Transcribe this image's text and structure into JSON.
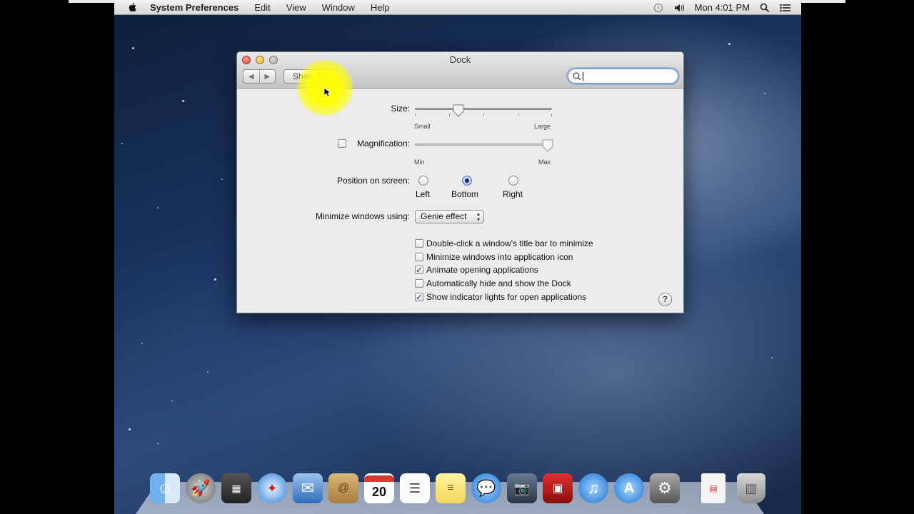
{
  "menubar": {
    "app": "System Preferences",
    "items": [
      "Edit",
      "View",
      "Window",
      "Help"
    ],
    "clock": "Mon 4:01 PM"
  },
  "window": {
    "title": "Dock",
    "nav_back": "◀",
    "nav_forward": "▶",
    "show_all": "Show All",
    "search_placeholder": ""
  },
  "dock_prefs": {
    "size_label": "Size:",
    "size_min": "Small",
    "size_max": "Large",
    "size_value": 0.32,
    "magnification_label": "Magnification:",
    "magnification_checked": false,
    "mag_min": "Min",
    "mag_max": "Max",
    "mag_value": 0.97,
    "position_label": "Position on screen:",
    "positions": [
      "Left",
      "Bottom",
      "Right"
    ],
    "position_selected": "Bottom",
    "minimize_label": "Minimize windows using:",
    "minimize_value": "Genie effect",
    "options": [
      {
        "label": "Double-click a window's title bar to minimize",
        "checked": false
      },
      {
        "label": "Minimize windows into application icon",
        "checked": false
      },
      {
        "label": "Animate opening applications",
        "checked": true
      },
      {
        "label": "Automatically hide and show the Dock",
        "checked": false
      },
      {
        "label": "Show indicator lights for open applications",
        "checked": true
      }
    ],
    "help": "?"
  },
  "dock": {
    "calendar_day": "20",
    "icons": [
      "finder-icon",
      "launchpad-icon",
      "mission-control-icon",
      "safari-icon",
      "mail-icon",
      "contacts-icon",
      "calendar-icon",
      "reminders-icon",
      "notes-icon",
      "messages-icon",
      "facetime-icon",
      "photo-booth-icon",
      "itunes-icon",
      "app-store-icon",
      "system-preferences-icon",
      "document-icon",
      "trash-icon"
    ]
  }
}
